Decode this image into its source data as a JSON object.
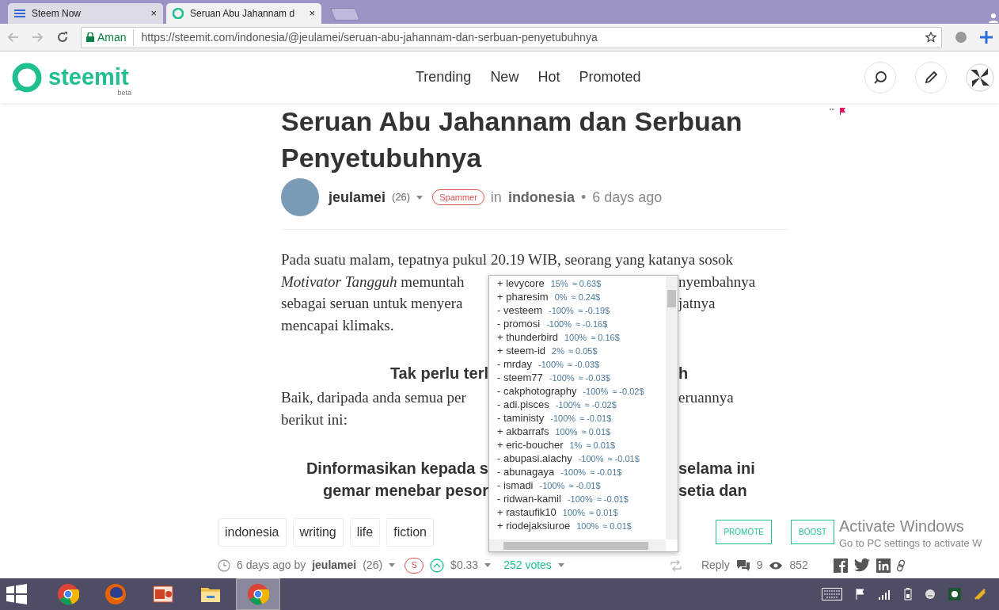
{
  "browser": {
    "tabs": [
      {
        "title": "Steem Now",
        "close": "×",
        "selected": false
      },
      {
        "title": "Seruan Abu Jahannam d",
        "close": "×",
        "selected": true
      }
    ],
    "secure_label": "Aman",
    "url": "https://steemit.com/indonesia/@jeulamei/seruan-abu-jahannam-dan-serbuan-penyetubuhnya"
  },
  "site": {
    "logo": "steemit",
    "logo_sub": "beta",
    "nav": [
      {
        "label": "Trending"
      },
      {
        "label": "New"
      },
      {
        "label": "Hot"
      },
      {
        "label": "Promoted"
      }
    ]
  },
  "post": {
    "title": "Seruan Abu Jahannam dan Serbuan Penyetubuhnya",
    "author": "jeulamei",
    "reputation": "(26)",
    "badge": "Spammer",
    "in_label": "in",
    "category": "indonesia",
    "separator": "•",
    "time": "6 days ago",
    "body": [
      {
        "kind": "text",
        "left": "Pada suatu malam, tepatnya pukul 20.19 WIB, seorang yang katanya sosok"
      },
      {
        "kind": "text",
        "left": "*Motivator Tangguh* memuntah",
        "right": "nyembahnya"
      },
      {
        "kind": "text",
        "left": "sebagai seruan untuk menyera",
        "right": "jatnya"
      },
      {
        "kind": "text",
        "left": "mencapai klimaks."
      },
      {
        "kind": "heading",
        "left": "Tak perlu terl",
        "right": "h"
      },
      {
        "kind": "text",
        "left": "Baik, daripada anda semua per",
        "right": "eruannya"
      },
      {
        "kind": "text",
        "left": "berikut ini:"
      },
      {
        "kind": "heading",
        "left": "Dinformasikan kepada s",
        "right": "selama ini"
      },
      {
        "kind": "heading",
        "left": "gemar menebar pesor",
        "right": "setia dan"
      }
    ]
  },
  "votes_popup": {
    "votes": [
      {
        "voter": "+ levycore",
        "percent": "15%",
        "value": "≈ 0.63$"
      },
      {
        "voter": "+ pharesim",
        "percent": "0%",
        "value": "≈ 0.24$"
      },
      {
        "voter": "- vesteem",
        "percent": "-100%",
        "value": "≈ -0.19$"
      },
      {
        "voter": "- promosi",
        "percent": "-100%",
        "value": "≈ -0.16$"
      },
      {
        "voter": "+ thunderbird",
        "percent": "100%",
        "value": "≈ 0.16$"
      },
      {
        "voter": "+ steem-id",
        "percent": "2%",
        "value": "≈ 0.05$"
      },
      {
        "voter": "- mrday",
        "percent": "-100%",
        "value": "≈ -0.03$"
      },
      {
        "voter": "- steem77",
        "percent": "-100%",
        "value": "≈ -0.03$"
      },
      {
        "voter": "- cakphotography",
        "percent": "-100%",
        "value": "≈ -0.02$"
      },
      {
        "voter": "- adi.pisces",
        "percent": "-100%",
        "value": "≈ -0.02$"
      },
      {
        "voter": "- taministy",
        "percent": "-100%",
        "value": "≈ -0.01$"
      },
      {
        "voter": "+ akbarrafs",
        "percent": "100%",
        "value": "≈ 0.01$"
      },
      {
        "voter": "+ eric-boucher",
        "percent": "1%",
        "value": "≈ 0.01$"
      },
      {
        "voter": "- abupasi.alachy",
        "percent": "-100%",
        "value": "≈ -0.01$"
      },
      {
        "voter": "- abunagaya",
        "percent": "-100%",
        "value": "≈ -0.01$"
      },
      {
        "voter": "- ismadi",
        "percent": "-100%",
        "value": "≈ -0.01$"
      },
      {
        "voter": "- ridwan-kamil",
        "percent": "-100%",
        "value": "≈ -0.01$"
      },
      {
        "voter": "+ rastaufik10",
        "percent": "100%",
        "value": "≈ 0.01$"
      },
      {
        "voter": "+ riodejaksiuroe",
        "percent": "100%",
        "value": "≈ 0.01$"
      }
    ]
  },
  "footer": {
    "tags": [
      "indonesia",
      "writing",
      "life",
      "fiction"
    ],
    "promote": "PROMOTE",
    "boost": "BOOST",
    "time_by": "6 days ago by",
    "author": "jeulamei",
    "reputation": "(26)",
    "flag_badge": "S",
    "payout": "$0.33",
    "votes": "252 votes",
    "reply": "Reply",
    "comments": "9",
    "views": "852"
  },
  "os_notice": {
    "title": "Activate Windows",
    "subtitle": "Go to PC settings to activate W"
  },
  "taskbar": {
    "apps": [
      {
        "kind": "chrome",
        "selected": false
      },
      {
        "kind": "firefox",
        "selected": false
      },
      {
        "kind": "powerpoint",
        "selected": false
      },
      {
        "kind": "explorer",
        "selected": false
      },
      {
        "kind": "chrome",
        "selected": true
      }
    ]
  }
}
